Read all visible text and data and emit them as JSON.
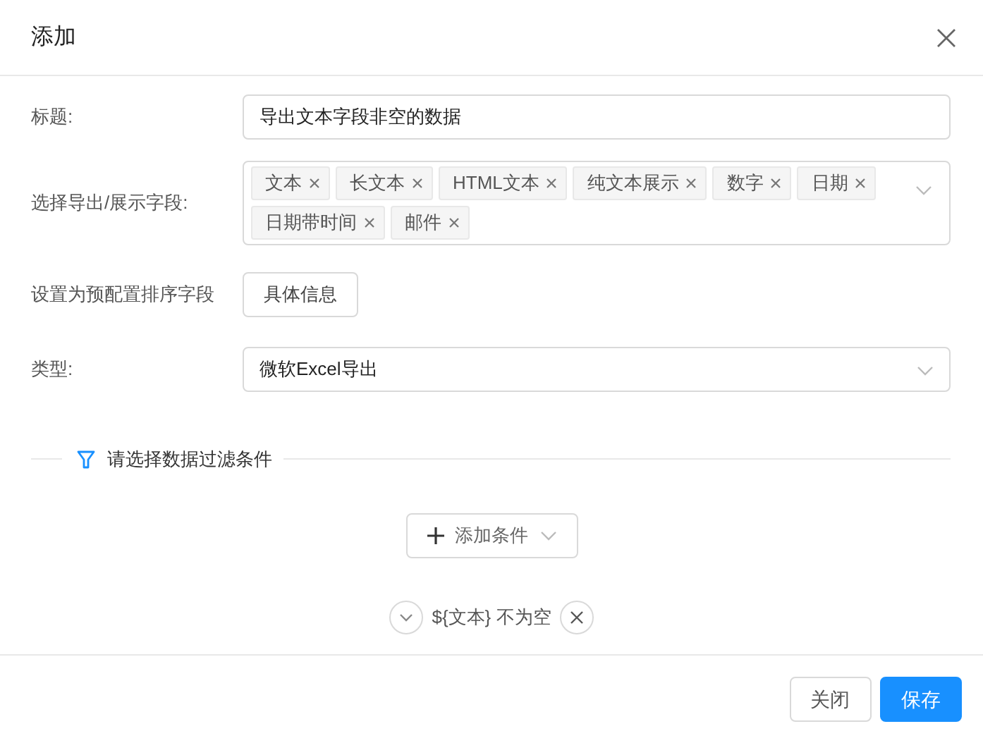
{
  "dialog": {
    "title": "添加"
  },
  "fields": [
    {
      "kind": "input",
      "label": "标题:",
      "value": "导出文本字段非空的数据"
    },
    {
      "kind": "tags",
      "label": "选择导出/展示字段:",
      "tags": [
        "文本",
        "长文本",
        "HTML文本",
        "纯文本展示",
        "数字",
        "日期",
        "日期带时间",
        "邮件"
      ]
    },
    {
      "kind": "button",
      "label": "设置为预配置排序字段",
      "button": "具体信息"
    },
    {
      "kind": "select",
      "label": "类型:",
      "value": "微软Excel导出"
    }
  ],
  "filter": {
    "title": "请选择数据过滤条件",
    "add_button": "添加条件",
    "conditions": [
      {
        "text": "${文本} 不为空",
        "expanded": false
      }
    ]
  },
  "footer": {
    "buttons": [
      {
        "label": "关闭",
        "primary": false
      },
      {
        "label": "保存",
        "primary": true
      }
    ]
  }
}
